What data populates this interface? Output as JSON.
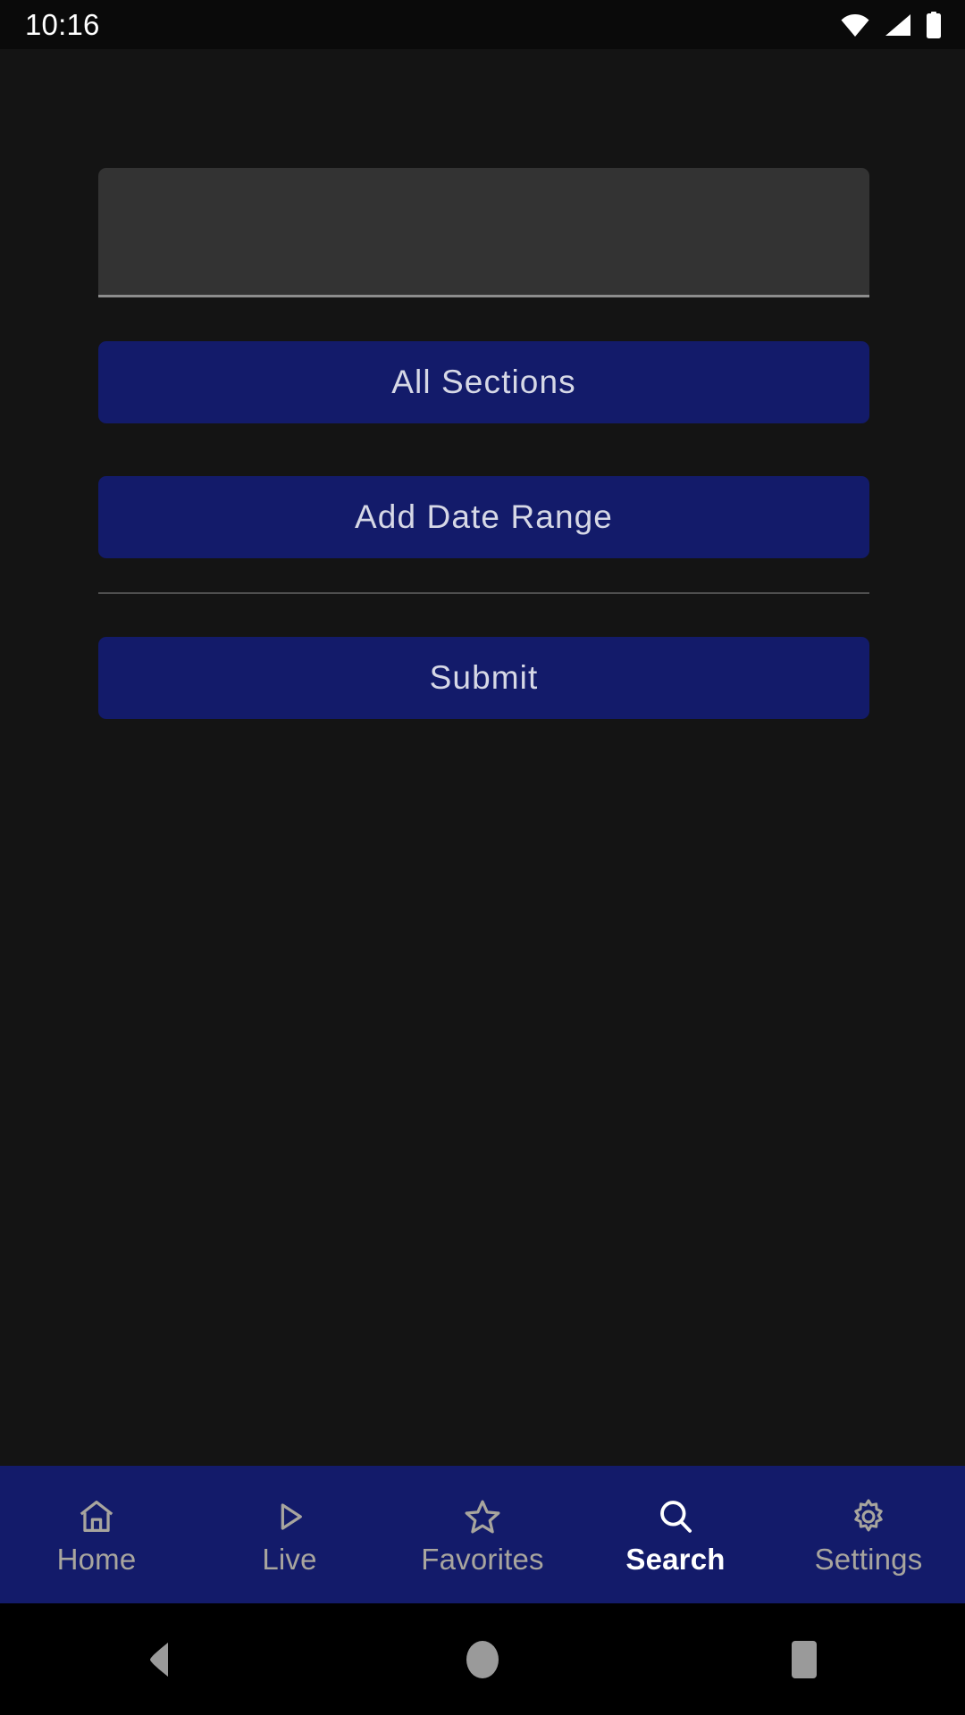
{
  "status_bar": {
    "time": "10:16",
    "icons": [
      "wifi-icon",
      "cellular-signal-icon",
      "battery-icon"
    ]
  },
  "search_form": {
    "query_input": {
      "value": "",
      "placeholder": ""
    },
    "sections_button_label": "All Sections",
    "date_range_button_label": "Add Date Range",
    "submit_button_label": "Submit"
  },
  "tab_bar": {
    "active": "Search",
    "tabs": [
      {
        "label": "Home",
        "icon": "home-icon"
      },
      {
        "label": "Live",
        "icon": "play-icon"
      },
      {
        "label": "Favorites",
        "icon": "star-icon"
      },
      {
        "label": "Search",
        "icon": "search-icon"
      },
      {
        "label": "Settings",
        "icon": "gear-icon"
      }
    ]
  },
  "system_nav": {
    "buttons": [
      {
        "name": "back",
        "icon": "triangle-left-icon"
      },
      {
        "name": "home",
        "icon": "circle-icon"
      },
      {
        "name": "recents",
        "icon": "square-icon"
      }
    ]
  },
  "colors": {
    "background": "#141414",
    "accent_navy": "#131b6a",
    "status_bar_bg": "#0a0a0a",
    "field_bg": "#333333",
    "field_underline": "#8d8d8d",
    "divider": "#4f4f4f",
    "button_text": "#d6d8e6",
    "tab_inactive": "#a8a59e",
    "tab_active": "#ffffff",
    "system_nav_bg": "#000000",
    "system_nav_icon": "#9a9a9a"
  }
}
